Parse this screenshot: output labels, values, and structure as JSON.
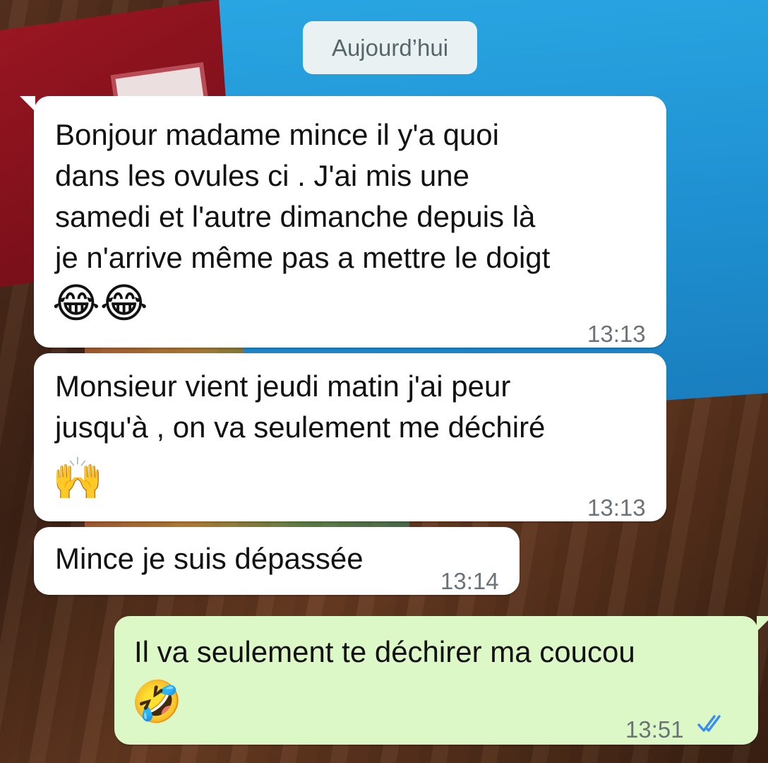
{
  "chat": {
    "date_label": "Aujourd’hui",
    "messages": [
      {
        "direction": "incoming",
        "text": "Bonjour madame mince il y'a quoi\ndans les ovules ci . J'ai mis une\nsamedi et l'autre dimanche depuis là\nje n'arrive même pas a mettre le doigt",
        "emoji": "😂😂",
        "time": "13:13"
      },
      {
        "direction": "incoming",
        "text": "Monsieur vient jeudi matin j'ai peur\njusqu'à , on va seulement me déchiré",
        "emoji": "🙌",
        "time": "13:13"
      },
      {
        "direction": "incoming",
        "text": "Mince je suis dépassée",
        "time": "13:14"
      },
      {
        "direction": "outgoing",
        "text": "Il va seulement te déchirer ma coucou",
        "emoji": "🤣",
        "time": "13:51",
        "status": "read",
        "status_icon": "double-check-icon"
      }
    ]
  },
  "colors": {
    "incoming_bubble": "#ffffff",
    "outgoing_bubble": "#dcf8c6",
    "read_ticks": "#3a8ef0",
    "timestamp": "#6b7378"
  }
}
